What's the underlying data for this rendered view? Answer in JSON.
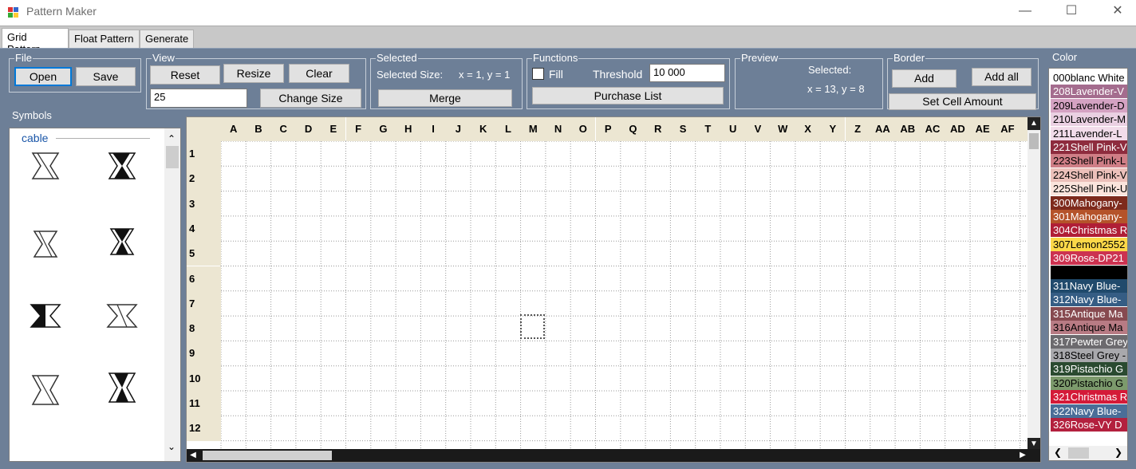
{
  "window": {
    "title": "Pattern Maker"
  },
  "tabs": [
    {
      "label": "Grid Pattern"
    },
    {
      "label": "Float Pattern"
    },
    {
      "label": "Generate"
    }
  ],
  "file": {
    "title": "File",
    "open": "Open",
    "save": "Save"
  },
  "view": {
    "title": "View",
    "reset": "Reset",
    "resize": "Resize",
    "clear": "Clear",
    "size_value": "25",
    "change_size": "Change Size"
  },
  "selected": {
    "title": "Selected",
    "size_label": "Selected Size:",
    "size_value": "x = 1, y = 1",
    "merge": "Merge"
  },
  "functions": {
    "title": "Functions",
    "fill": "Fill",
    "threshold_label": "Threshold",
    "threshold_value": "10 000",
    "purchase_list": "Purchase List"
  },
  "preview": {
    "title": "Preview",
    "selected_label": "Selected:",
    "selected_value": "x = 13, y = 8"
  },
  "border": {
    "title": "Border",
    "add": "Add",
    "add_all": "Add all",
    "set_cell_amount": "Set Cell Amount"
  },
  "symbols": {
    "title": "Symbols",
    "category": "cable"
  },
  "grid": {
    "columns": [
      "A",
      "B",
      "C",
      "D",
      "E",
      "F",
      "G",
      "H",
      "I",
      "J",
      "K",
      "L",
      "M",
      "N",
      "O",
      "P",
      "Q",
      "R",
      "S",
      "T",
      "U",
      "V",
      "W",
      "X",
      "Y",
      "Z",
      "AA",
      "AB",
      "AC",
      "AD",
      "AE",
      "AF",
      "A"
    ],
    "rows": [
      "1",
      "2",
      "3",
      "4",
      "5",
      "6",
      "7",
      "8",
      "9",
      "10",
      "11",
      "12"
    ]
  },
  "colors": {
    "title": "Color",
    "items": [
      {
        "label": "000blanc White",
        "bg": "#ffffff",
        "fg": "#000000"
      },
      {
        "label": "208Lavender-V",
        "bg": "#a46c8e",
        "fg": "#ffffff"
      },
      {
        "label": "209Lavender-D",
        "bg": "#d4a2c2",
        "fg": "#000000"
      },
      {
        "label": "210Lavender-M",
        "bg": "#ead0e2",
        "fg": "#000000"
      },
      {
        "label": "211Lavender-L",
        "bg": "#f2dcea",
        "fg": "#000000"
      },
      {
        "label": "221Shell Pink-V",
        "bg": "#8e2c3e",
        "fg": "#ffffff"
      },
      {
        "label": "223Shell Pink-L",
        "bg": "#cf7e86",
        "fg": "#000000"
      },
      {
        "label": "224Shell Pink-V",
        "bg": "#ecc0ba",
        "fg": "#000000"
      },
      {
        "label": "225Shell Pink-U",
        "bg": "#fbe4dc",
        "fg": "#000000"
      },
      {
        "label": "300Mahogany-",
        "bg": "#7e2a1c",
        "fg": "#ffffff"
      },
      {
        "label": "301Mahogany-",
        "bg": "#b5532a",
        "fg": "#ffffff"
      },
      {
        "label": "304Christmas R",
        "bg": "#b01e36",
        "fg": "#ffffff"
      },
      {
        "label": "307Lemon2552",
        "bg": "#fcd848",
        "fg": "#000000"
      },
      {
        "label": "309Rose-DP21",
        "bg": "#cc3250",
        "fg": "#ffffff"
      },
      {
        "label": "",
        "bg": "#000000",
        "fg": "#ffffff"
      },
      {
        "label": "311Navy Blue-",
        "bg": "#204a6c",
        "fg": "#ffffff"
      },
      {
        "label": "312Navy Blue-",
        "bg": "#355d84",
        "fg": "#ffffff"
      },
      {
        "label": "315Antique Ma",
        "bg": "#874a50",
        "fg": "#ffffff"
      },
      {
        "label": "316Antique Ma",
        "bg": "#b87b84",
        "fg": "#000000"
      },
      {
        "label": "317Pewter Grey",
        "bg": "#6c6a6e",
        "fg": "#ffffff"
      },
      {
        "label": "318Steel Grey -",
        "bg": "#a8a8ac",
        "fg": "#000000"
      },
      {
        "label": "319Pistachio G",
        "bg": "#2a4a30",
        "fg": "#ffffff"
      },
      {
        "label": "320Pistachio G",
        "bg": "#7c9a6c",
        "fg": "#000000"
      },
      {
        "label": "321Christmas R",
        "bg": "#d41a38",
        "fg": "#ffffff"
      },
      {
        "label": "322Navy Blue-",
        "bg": "#4a6e98",
        "fg": "#ffffff"
      },
      {
        "label": "326Rose-VY D",
        "bg": "#b3203e",
        "fg": "#ffffff"
      }
    ]
  },
  "accent": "#0078d7"
}
